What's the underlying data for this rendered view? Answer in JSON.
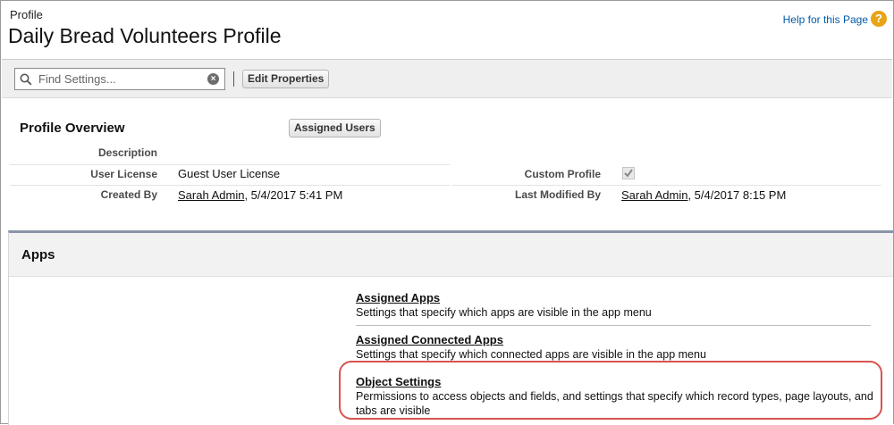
{
  "header": {
    "breadcrumb": "Profile",
    "title": "Daily Bread Volunteers Profile",
    "help_link": "Help for this Page",
    "help_icon": "question-circle-icon"
  },
  "toolbar": {
    "search_placeholder": "Find Settings...",
    "edit_button": "Edit Properties"
  },
  "overview": {
    "title": "Profile Overview",
    "assigned_users_button": "Assigned Users",
    "fields": {
      "description_label": "Description",
      "user_license_label": "User License",
      "user_license_value": "Guest User License",
      "created_by_label": "Created By",
      "created_by_name": "Sarah Admin",
      "created_by_date": ", 5/4/2017 5:41 PM",
      "custom_profile_label": "Custom Profile",
      "custom_profile_checked": true,
      "last_modified_label": "Last Modified By",
      "last_modified_name": "Sarah Admin",
      "last_modified_date": ", 5/4/2017 8:15 PM"
    }
  },
  "apps": {
    "title": "Apps",
    "items": [
      {
        "label": "Assigned Apps",
        "description": "Settings that specify which apps are visible in the app menu"
      },
      {
        "label": "Assigned Connected Apps",
        "description": "Settings that specify which connected apps are visible in the app menu"
      },
      {
        "label": "Object Settings",
        "description": "Permissions to access objects and fields, and settings that specify which record types, page layouts, and tabs are visible"
      }
    ]
  },
  "colors": {
    "link": "#015ba7",
    "help_icon": "#e8a317",
    "highlight": "#d9534f",
    "apps_border": "#8a94a8"
  }
}
